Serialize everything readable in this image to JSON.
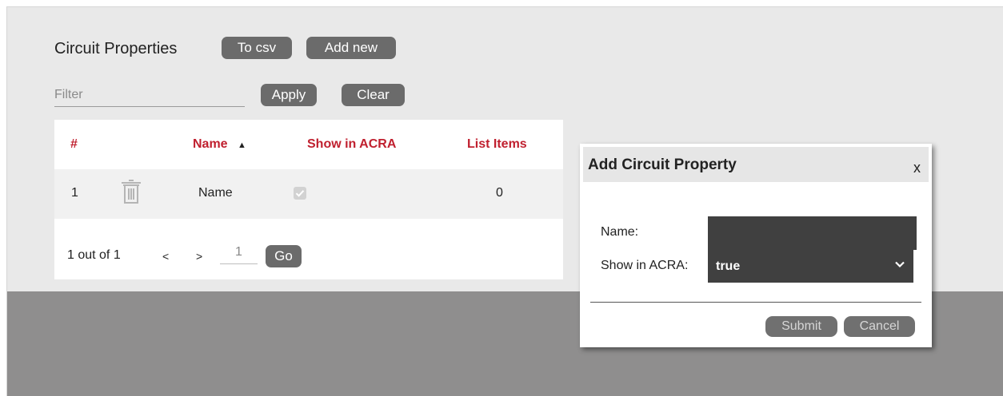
{
  "header": {
    "title": "Circuit Properties",
    "to_csv_label": "To csv",
    "add_new_label": "Add new"
  },
  "filter": {
    "placeholder": "Filter",
    "value": "",
    "apply_label": "Apply",
    "clear_label": "Clear"
  },
  "table": {
    "columns": {
      "index": "#",
      "name": "Name",
      "show_in_acra": "Show in ACRA",
      "list_items": "List Items"
    },
    "sort_indicator": "▲",
    "rows": [
      {
        "index": "1",
        "name": "Name",
        "show_in_acra": true,
        "list_items": "0"
      }
    ]
  },
  "pager": {
    "summary": "1 out of 1",
    "prev": "<",
    "next": ">",
    "page": "1",
    "go_label": "Go"
  },
  "dialog": {
    "title": "Add Circuit Property",
    "close_label": "x",
    "name_label": "Name:",
    "name_value": "",
    "show_label": "Show in ACRA:",
    "show_value": "true",
    "submit_label": "Submit",
    "cancel_label": "Cancel"
  },
  "colors": {
    "accent": "#c0202f",
    "button": "#6b6b6b",
    "panel": "#e9e9e9",
    "overlay": "#8f8e8e"
  }
}
